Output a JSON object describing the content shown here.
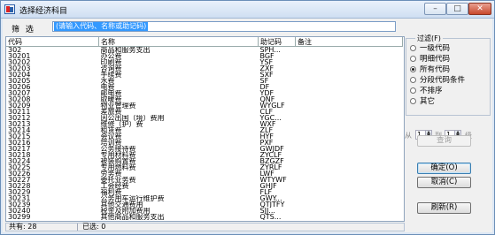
{
  "window": {
    "title": "选择经济科目",
    "minimize": "–",
    "maximize": "□",
    "close": "✕"
  },
  "filter": {
    "label": "筛 选",
    "value": "(请输入代码、名称或助记码)"
  },
  "table": {
    "headers": [
      "代码",
      "名称",
      "助记码",
      "备注"
    ],
    "rows": [
      [
        "302",
        "商品和服务支出",
        "SPH...",
        ""
      ],
      [
        "30201",
        "办公费",
        "BGF",
        ""
      ],
      [
        "30202",
        "印刷费",
        "YSF",
        ""
      ],
      [
        "30203",
        "咨询费",
        "ZXF",
        ""
      ],
      [
        "30204",
        "手续费",
        "SXF",
        ""
      ],
      [
        "30205",
        "水费",
        "SF",
        ""
      ],
      [
        "30206",
        "电费",
        "DF",
        ""
      ],
      [
        "30207",
        "邮电费",
        "YDF",
        ""
      ],
      [
        "30208",
        "取暖费",
        "QNF",
        ""
      ],
      [
        "30209",
        "物业管理费",
        "WYGLF",
        ""
      ],
      [
        "30211",
        "差旅费",
        "CLF",
        ""
      ],
      [
        "30212",
        "因公出国（境）费用",
        "YGC...",
        ""
      ],
      [
        "30213",
        "维修（护）费",
        "WXF",
        ""
      ],
      [
        "30214",
        "租赁费",
        "ZLF",
        ""
      ],
      [
        "30215",
        "会议费",
        "HYF",
        ""
      ],
      [
        "30216",
        "培训费",
        "PXF",
        ""
      ],
      [
        "30217",
        "公务接待费",
        "GWJDF",
        ""
      ],
      [
        "30218",
        "专用材料费",
        "ZYCLF",
        ""
      ],
      [
        "30224",
        "被装购置费",
        "BZGZF",
        ""
      ],
      [
        "30225",
        "专用燃料费",
        "ZYRLF",
        ""
      ],
      [
        "30226",
        "劳务费",
        "LWF",
        ""
      ],
      [
        "30227",
        "委托业务费",
        "WTYWF",
        ""
      ],
      [
        "30228",
        "工会经费",
        "GHJF",
        ""
      ],
      [
        "30229",
        "福利费",
        "FLF",
        ""
      ],
      [
        "30231",
        "公务用车运行维护费",
        "GWY...",
        ""
      ],
      [
        "30239",
        "其他交通费用",
        "QTJTFY",
        ""
      ],
      [
        "30240",
        "税金及附加费用",
        "SJJ...",
        ""
      ],
      [
        "30299",
        "其他商品和服务支出",
        "QTS...",
        ""
      ]
    ]
  },
  "status": {
    "total": "共有: 28",
    "selected": "已选: 0"
  },
  "filter_group": {
    "title": "过滤(F)",
    "options": [
      {
        "label": "一级代码",
        "selected": false
      },
      {
        "label": "明细代码",
        "selected": false
      },
      {
        "label": "所有代码",
        "selected": true
      },
      {
        "label": "分段代码条件",
        "selected": false
      },
      {
        "label": "不排序",
        "selected": false
      },
      {
        "label": "其它",
        "selected": false
      }
    ]
  },
  "level_range": {
    "from_label": "从",
    "from_value": "1",
    "to_label": "到",
    "to_value": "1",
    "unit": "级"
  },
  "buttons": {
    "query": "查询",
    "ok": "确定(O)",
    "cancel": "取消(C)",
    "refresh": "刷新(R)"
  }
}
